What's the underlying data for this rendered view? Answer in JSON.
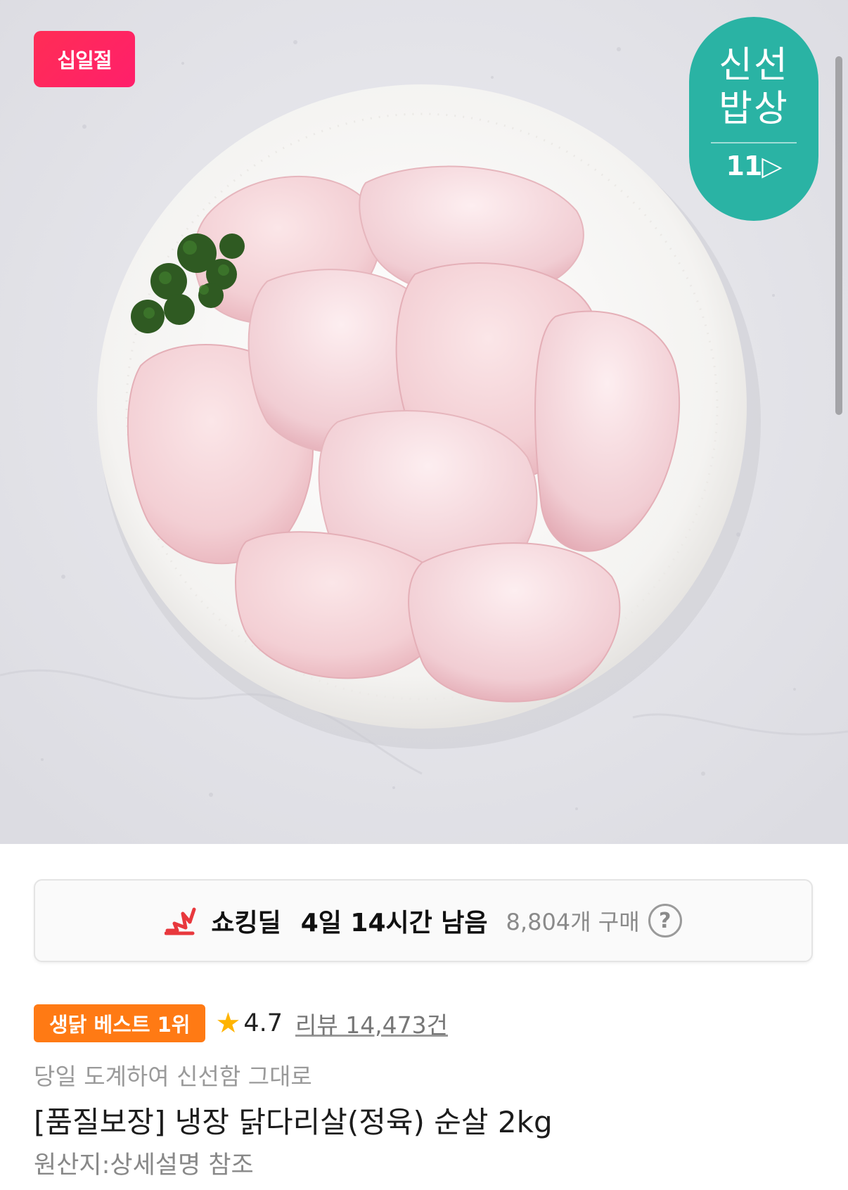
{
  "hero": {
    "event_badge": "십일절",
    "fresh_badge": {
      "line1": "신선",
      "line2": "밥상",
      "logo": "11▷"
    }
  },
  "deal": {
    "name": "쇼킹딜",
    "time_left": "4일 14시간 남음",
    "purchase_count": "8,804개 구매",
    "help": "?"
  },
  "product": {
    "rank_badge": "생닭 베스트 1위",
    "rating": "4.7",
    "reviews": "리뷰 14,473건",
    "subtitle": "당일 도계하여 신선함 그대로",
    "title": "[품질보장] 냉장 닭다리살(정육) 순살 2kg",
    "origin": "원산지:상세설명 참조"
  },
  "colors": {
    "event_badge": "#ff2d55",
    "fresh_badge": "#2ab3a4",
    "rank_badge": "#ff7a14",
    "star": "#ffb400",
    "deal_icon": "#e8383d"
  }
}
